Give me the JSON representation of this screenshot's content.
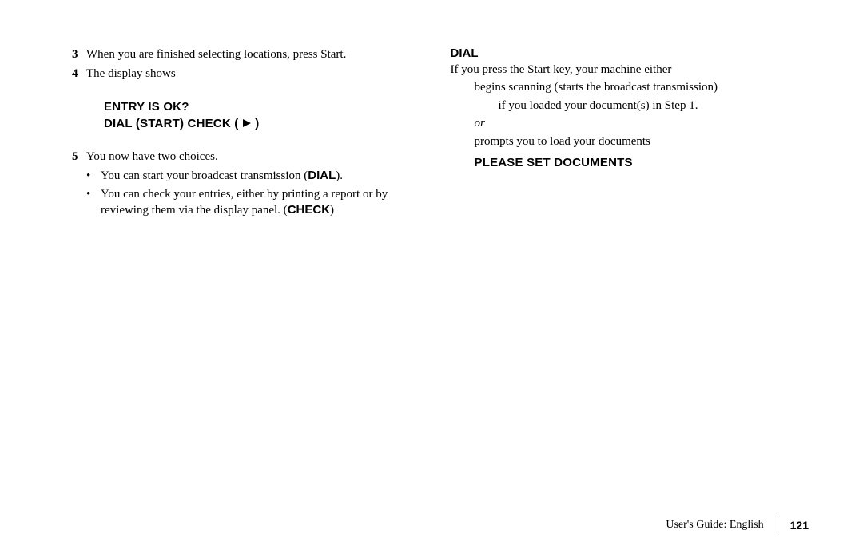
{
  "left": {
    "step3_num": "3",
    "step3_text": "When you are finished selecting locations, press Start.",
    "step4_num": "4",
    "step4_text": "The display shows",
    "display_line1": "ENTRY IS OK?",
    "display_line2_a": "DIAL (START) CHECK (",
    "display_line2_b": ")",
    "step5_num": "5",
    "step5_text": "You now have two choices.",
    "bullet1_a": "You can start your broadcast transmission (",
    "bullet1_bold": "DIAL",
    "bullet1_b": ").",
    "bullet2_a": "You can check your entries, either by printing a report or by reviewing them via the display panel. (",
    "bullet2_bold": "CHECK",
    "bullet2_b": ")"
  },
  "right": {
    "heading": "DIAL",
    "intro": "If you press the Start key, your machine either",
    "line_begins": "begins scanning (starts the broadcast transmission)",
    "line_ifloaded": "if you loaded your document(s) in Step 1.",
    "or": "or",
    "prompts": "prompts you to load your documents",
    "display_set": "PLEASE SET DOCUMENTS"
  },
  "footer": {
    "guide": "User's Guide:  English",
    "page": "121"
  }
}
